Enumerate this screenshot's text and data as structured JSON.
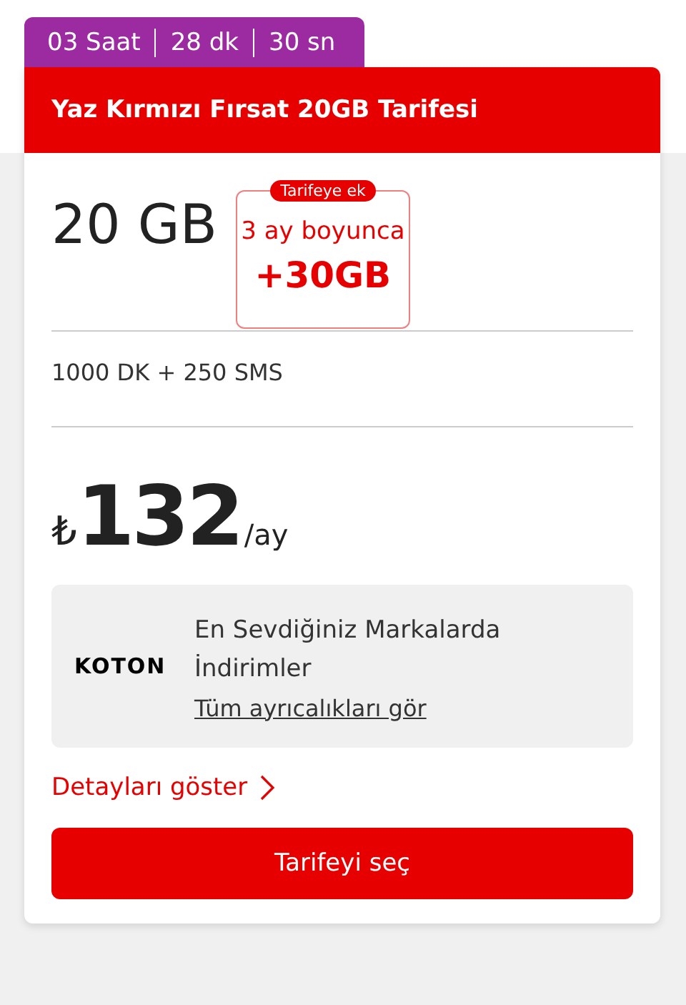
{
  "countdown": [
    "03 Saat",
    "28 dk",
    "30 sn"
  ],
  "title": "Yaz Kırmızı Fırsat 20GB Tarifesi",
  "data_amount": "20 GB",
  "bonus": {
    "badge": "Tarifeye ek",
    "duration": "3 ay boyunca",
    "amount": "+30GB"
  },
  "minutes_sms": "1000 DK + 250 SMS",
  "price": {
    "currency": "₺",
    "amount": "132",
    "period": "/ay"
  },
  "perk": {
    "brand": "KOTON",
    "lines": [
      "En Sevdiğiniz Markalarda",
      "İndirimler"
    ],
    "link": "Tüm ayrıcalıkları gör"
  },
  "details_link": "Detayları göster",
  "select_button": "Tarifeyi seç"
}
